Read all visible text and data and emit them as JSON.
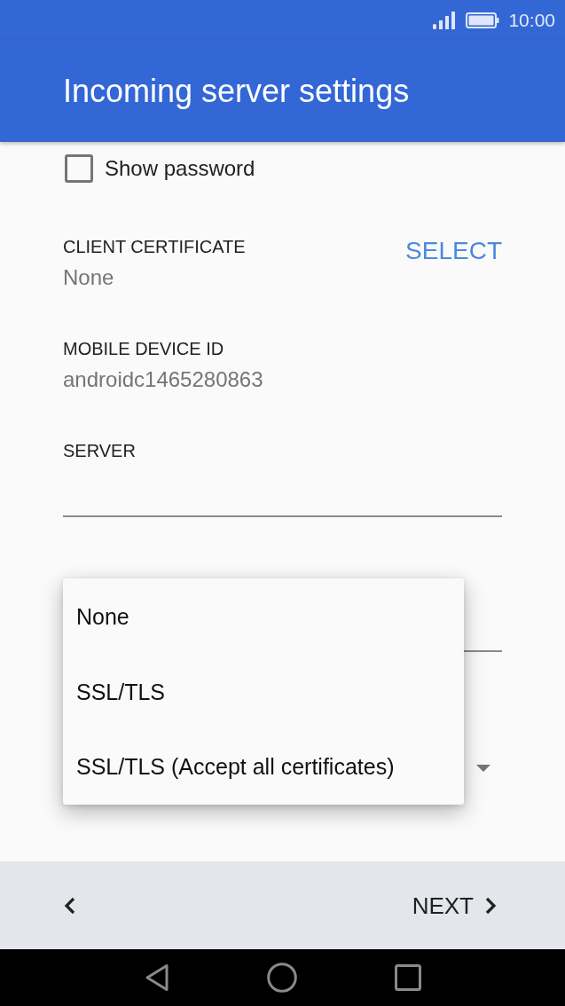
{
  "status_bar": {
    "time": "10:00"
  },
  "app_bar": {
    "title": "Incoming server settings"
  },
  "show_password": {
    "label": "Show password",
    "checked": false
  },
  "client_certificate": {
    "label": "CLIENT CERTIFICATE",
    "value": "None",
    "action": "SELECT"
  },
  "mobile_device_id": {
    "label": "MOBILE DEVICE ID",
    "value": "androidc1465280863"
  },
  "server": {
    "label": "SERVER"
  },
  "security_menu": {
    "options": [
      {
        "label": "None",
        "selected": false
      },
      {
        "label": "SSL/TLS",
        "selected": false
      },
      {
        "label": "SSL/TLS (Accept all certificates)",
        "selected": false
      }
    ]
  },
  "bottom_bar": {
    "next": "NEXT"
  }
}
